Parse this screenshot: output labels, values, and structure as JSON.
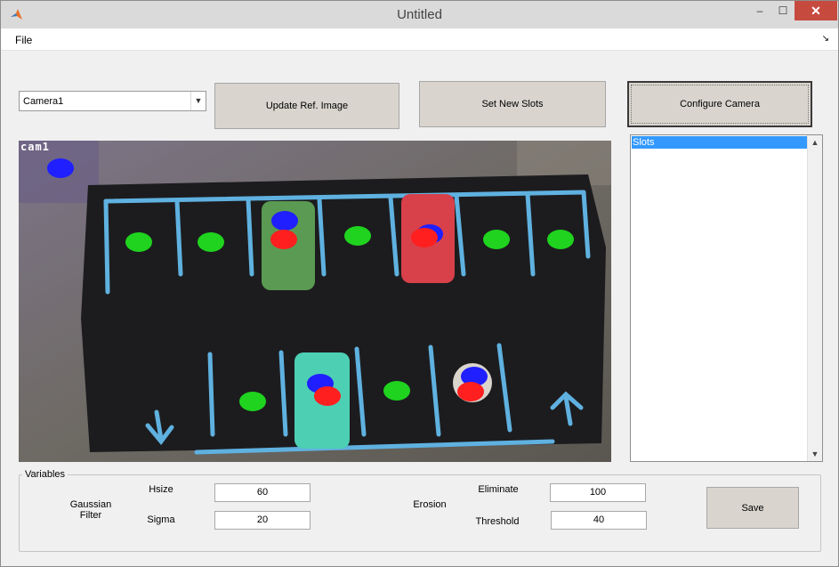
{
  "window": {
    "title": "Untitled",
    "controls": {
      "minimize": "‒",
      "maximize": "☐",
      "close": "✕"
    }
  },
  "menu": {
    "file": "File",
    "overflow_arrow": "↘"
  },
  "camera_select": {
    "value": "Camera1"
  },
  "buttons": {
    "update_ref": "Update Ref. Image",
    "set_slots": "Set New Slots",
    "configure_camera": "Configure Camera",
    "save": "Save"
  },
  "camera_view": {
    "overlay_label": "cam1"
  },
  "slots_list": {
    "items": [
      "Slots"
    ]
  },
  "variables": {
    "title": "Variables",
    "gaussian_label": "Gaussian Filter",
    "hsize_label": "Hsize",
    "hsize_value": "60",
    "sigma_label": "Sigma",
    "sigma_value": "20",
    "erosion_label": "Erosion",
    "eliminate_label": "Eliminate",
    "eliminate_value": "100",
    "threshold_label": "Threshold",
    "threshold_value": "40"
  },
  "colors": {
    "marker_green": "#1fd31f",
    "marker_blue": "#1f1fff",
    "marker_red": "#ff1f1f",
    "chalk_lines": "#5fb1e0",
    "board": "#1c1c1e",
    "selection": "#3399ff"
  }
}
